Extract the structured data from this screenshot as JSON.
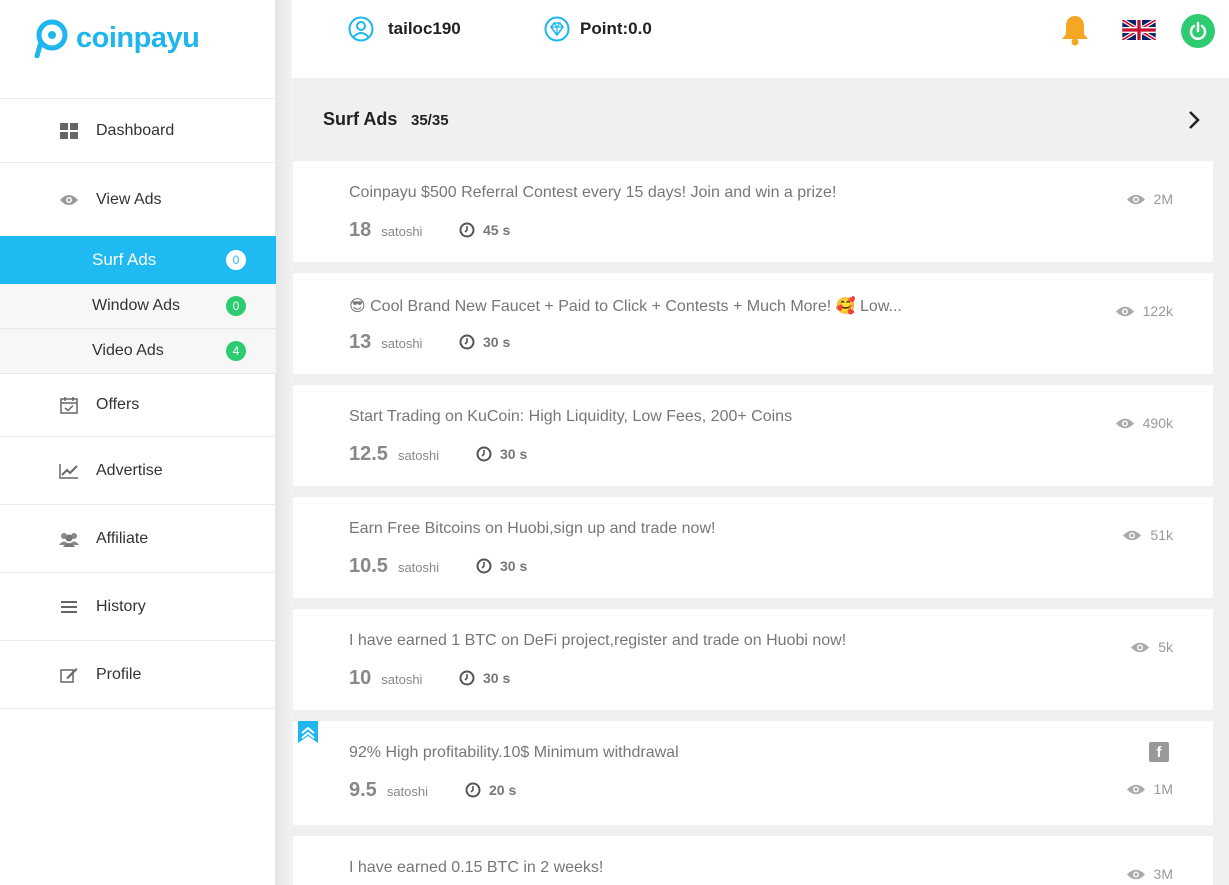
{
  "brand": {
    "name": "coinpayu",
    "color": "#1fb6ee"
  },
  "sidebar": {
    "items": [
      {
        "label": "Dashboard",
        "icon": "dashboard-icon"
      },
      {
        "label": "View Ads",
        "icon": "eye-icon"
      },
      {
        "label": "Offers",
        "icon": "calendar-check-icon"
      },
      {
        "label": "Advertise",
        "icon": "line-chart-icon"
      },
      {
        "label": "Affiliate",
        "icon": "users-icon"
      },
      {
        "label": "History",
        "icon": "list-icon"
      },
      {
        "label": "Profile",
        "icon": "edit-icon"
      }
    ],
    "subitems": [
      {
        "label": "Surf Ads",
        "badge": "0",
        "active": true
      },
      {
        "label": "Window Ads",
        "badge": "0"
      },
      {
        "label": "Video Ads",
        "badge": "4"
      }
    ]
  },
  "header": {
    "username": "tailoc190",
    "points": "Point:0.0"
  },
  "section": {
    "title": "Surf Ads",
    "count": "35/35"
  },
  "ads": [
    {
      "title": "Coinpayu $500 Referral Contest every 15 days! Join and win a prize!",
      "amount": "18",
      "unit": "satoshi",
      "time": "45 s",
      "views": "2M"
    },
    {
      "title": "😎 Cool Brand New Faucet + Paid to Click + Contests + Much More! 🥰 Low...",
      "amount": "13",
      "unit": "satoshi",
      "time": "30 s",
      "views": "122k"
    },
    {
      "title": "Start Trading on KuCoin: High Liquidity, Low Fees, 200+ Coins",
      "amount": "12.5",
      "unit": "satoshi",
      "time": "30 s",
      "views": "490k"
    },
    {
      "title": "Earn Free Bitcoins on Huobi,sign up and trade now!",
      "amount": "10.5",
      "unit": "satoshi",
      "time": "30 s",
      "views": "51k"
    },
    {
      "title": "I have earned 1 BTC on DeFi project,register and trade on Huobi now!",
      "amount": "10",
      "unit": "satoshi",
      "time": "30 s",
      "views": "5k"
    },
    {
      "title": "92% High profitability.10$ Minimum withdrawal",
      "amount": "9.5",
      "unit": "satoshi",
      "time": "20 s",
      "views": "1M",
      "facebook": "f"
    },
    {
      "title": "I have earned 0.15 BTC in 2 weeks!",
      "views": "3M"
    }
  ]
}
